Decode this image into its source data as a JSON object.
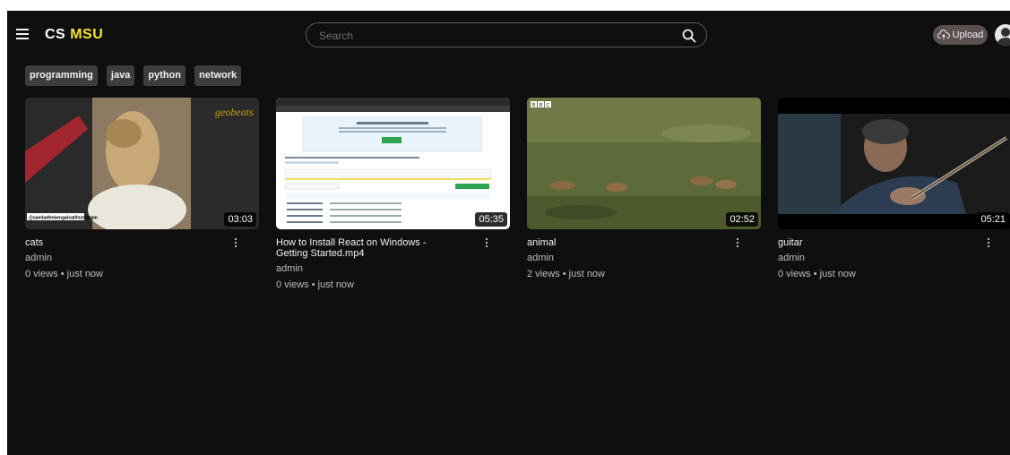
{
  "header": {
    "logo_part1": "CS",
    "logo_part2": "MSU",
    "search_placeholder": "Search",
    "upload_label": "Upload"
  },
  "chips": [
    "programming",
    "java",
    "python",
    "network"
  ],
  "videos": [
    {
      "title": "cats",
      "channel": "admin",
      "stats": "0 views • just now",
      "duration": "03:03",
      "watermark": "geobeats",
      "credit": "@sambathebengalcat/Instagram"
    },
    {
      "title": "How to Install React on Windows - Getting Started.mp4",
      "channel": "admin",
      "stats": "0 views • just now",
      "duration": "05:35"
    },
    {
      "title": "animal",
      "channel": "admin",
      "stats": "2 views • just now",
      "duration": "02:52",
      "badge": "BBC"
    },
    {
      "title": "guitar",
      "channel": "admin",
      "stats": "0 views • just now",
      "duration": "05:21"
    }
  ],
  "colors": {
    "background": "#0f0f0f",
    "logo_accent": "#f5e625",
    "chip": "#3d3d3d",
    "upload": "#5b5050"
  },
  "icons": {
    "menu": "hamburger-icon",
    "search": "search-icon",
    "upload": "cloud-upload-icon",
    "more": "more-vert-icon",
    "user": "user-avatar-icon"
  }
}
